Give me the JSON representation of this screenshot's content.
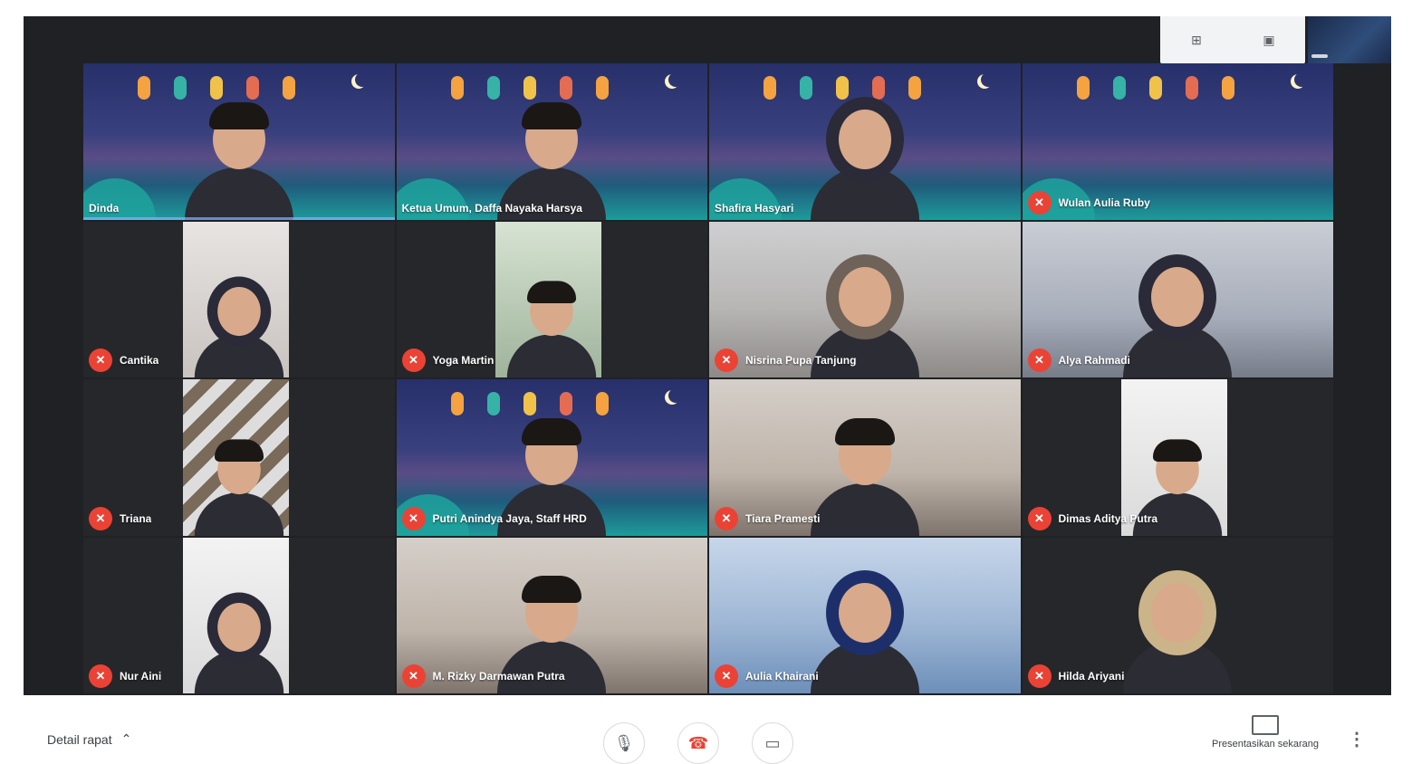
{
  "top_panel": {
    "icons": [
      "layout-icon",
      "screen-icon"
    ]
  },
  "tiles": [
    {
      "name": "Dinda",
      "style": "ramadan",
      "muted": false,
      "person": "hair"
    },
    {
      "name": "Ketua Umum, Daffa Nayaka Harsya",
      "style": "ramadan",
      "muted": false,
      "person": "hair"
    },
    {
      "name": "Shafira Hasyari",
      "style": "ramadan",
      "muted": false,
      "person": "hijab"
    },
    {
      "name": "Wulan Aulia Ruby",
      "style": "ramadan",
      "muted": true,
      "person": "none"
    },
    {
      "name": "Cantika",
      "style": "dark",
      "muted": true,
      "person": "hijab",
      "inset": "light"
    },
    {
      "name": "Yoga Martin",
      "style": "dark",
      "muted": true,
      "person": "hair",
      "inset": "green"
    },
    {
      "name": "Nisrina Pupa Tanjung",
      "style": "room-grey",
      "muted": true,
      "person": "hijab-grey"
    },
    {
      "name": "Alya Rahmadi",
      "style": "room-cool",
      "muted": true,
      "person": "hijab"
    },
    {
      "name": "Triana",
      "style": "dark",
      "muted": true,
      "person": "hair",
      "inset": "stripe"
    },
    {
      "name": "Putri Anindya Jaya, Staff HRD",
      "style": "ramadan",
      "muted": true,
      "person": "hair"
    },
    {
      "name": "Tiara Pramesti",
      "style": "room-warm",
      "muted": true,
      "person": "hair"
    },
    {
      "name": "Dimas Aditya Putra",
      "style": "dark",
      "muted": true,
      "person": "hair",
      "inset": "pale"
    },
    {
      "name": "Nur Aini",
      "style": "dark",
      "muted": true,
      "person": "hijab",
      "inset": "pale"
    },
    {
      "name": "M. Rizky Darmawan Putra",
      "style": "room-warm",
      "muted": true,
      "person": "hair"
    },
    {
      "name": "Aulia Khairani",
      "style": "room-blue",
      "muted": true,
      "person": "hijab-navy"
    },
    {
      "name": "Hilda Ariyani",
      "style": "dark",
      "muted": true,
      "person": "hijab-beige"
    }
  ],
  "bottom_bar": {
    "meeting_details": "Detail rapat",
    "controls": [
      "mic-icon",
      "hangup-icon",
      "camera-icon"
    ],
    "present_label": "Presentasikan sekarang"
  },
  "colors": {
    "mic_off": "#ea4335",
    "background": "#202124",
    "hangup": "#ea4335"
  }
}
